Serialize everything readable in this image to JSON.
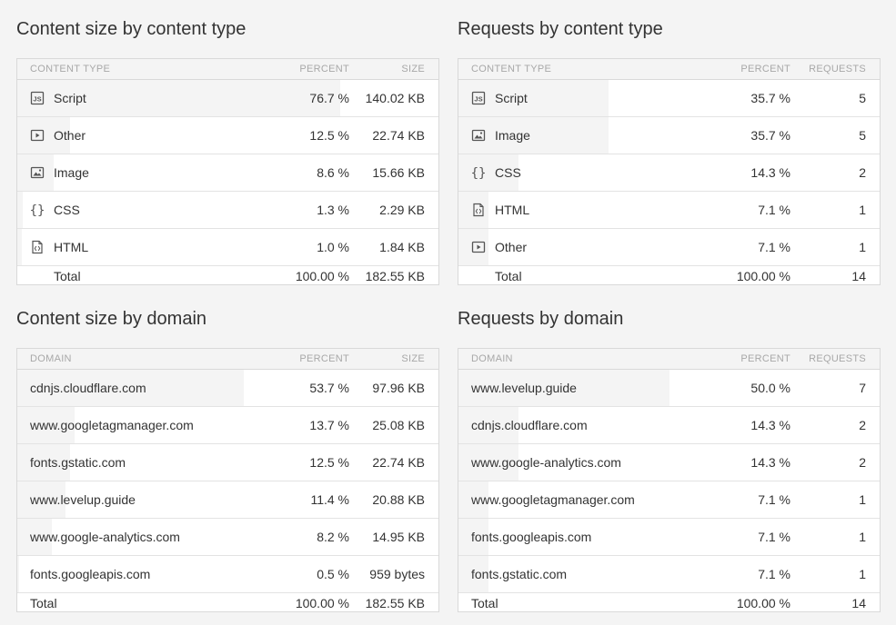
{
  "panels": {
    "size_type": {
      "title": "Content size by content type",
      "headers": {
        "name": "CONTENT TYPE",
        "pct": "PERCENT",
        "val": "SIZE"
      },
      "rows": [
        {
          "icon": "js-file-icon",
          "name": "Script",
          "pct": "76.7 %",
          "val": "140.02 KB",
          "fraction": 0.767
        },
        {
          "icon": "video-icon",
          "name": "Other",
          "pct": "12.5 %",
          "val": "22.74 KB",
          "fraction": 0.125
        },
        {
          "icon": "image-icon",
          "name": "Image",
          "pct": "8.6 %",
          "val": "15.66 KB",
          "fraction": 0.086
        },
        {
          "icon": "css-braces-icon",
          "name": "CSS",
          "pct": "1.3 %",
          "val": "2.29 KB",
          "fraction": 0.013
        },
        {
          "icon": "html-file-icon",
          "name": "HTML",
          "pct": "1.0 %",
          "val": "1.84 KB",
          "fraction": 0.01
        }
      ],
      "total": {
        "label": "Total",
        "pct": "100.00 %",
        "val": "182.55 KB"
      }
    },
    "req_type": {
      "title": "Requests by content type",
      "headers": {
        "name": "CONTENT TYPE",
        "pct": "PERCENT",
        "val": "REQUESTS"
      },
      "rows": [
        {
          "icon": "js-file-icon",
          "name": "Script",
          "pct": "35.7 %",
          "val": "5",
          "fraction": 0.357
        },
        {
          "icon": "image-icon",
          "name": "Image",
          "pct": "35.7 %",
          "val": "5",
          "fraction": 0.357
        },
        {
          "icon": "css-braces-icon",
          "name": "CSS",
          "pct": "14.3 %",
          "val": "2",
          "fraction": 0.143
        },
        {
          "icon": "html-file-icon",
          "name": "HTML",
          "pct": "7.1 %",
          "val": "1",
          "fraction": 0.071
        },
        {
          "icon": "video-icon",
          "name": "Other",
          "pct": "7.1 %",
          "val": "1",
          "fraction": 0.071
        }
      ],
      "total": {
        "label": "Total",
        "pct": "100.00 %",
        "val": "14"
      }
    },
    "size_domain": {
      "title": "Content size by domain",
      "headers": {
        "name": "DOMAIN",
        "pct": "PERCENT",
        "val": "SIZE"
      },
      "rows": [
        {
          "name": "cdnjs.cloudflare.com",
          "pct": "53.7 %",
          "val": "97.96 KB",
          "fraction": 0.537
        },
        {
          "name": "www.googletagmanager.com",
          "pct": "13.7 %",
          "val": "25.08 KB",
          "fraction": 0.137
        },
        {
          "name": "fonts.gstatic.com",
          "pct": "12.5 %",
          "val": "22.74 KB",
          "fraction": 0.125
        },
        {
          "name": "www.levelup.guide",
          "pct": "11.4 %",
          "val": "20.88 KB",
          "fraction": 0.114
        },
        {
          "name": "www.google-analytics.com",
          "pct": "8.2 %",
          "val": "14.95 KB",
          "fraction": 0.082
        },
        {
          "name": "fonts.googleapis.com",
          "pct": "0.5 %",
          "val": "959 bytes",
          "fraction": 0.005
        }
      ],
      "total": {
        "label": "Total",
        "pct": "100.00 %",
        "val": "182.55 KB"
      }
    },
    "req_domain": {
      "title": "Requests by domain",
      "headers": {
        "name": "DOMAIN",
        "pct": "PERCENT",
        "val": "REQUESTS"
      },
      "rows": [
        {
          "name": "www.levelup.guide",
          "pct": "50.0 %",
          "val": "7",
          "fraction": 0.5
        },
        {
          "name": "cdnjs.cloudflare.com",
          "pct": "14.3 %",
          "val": "2",
          "fraction": 0.143
        },
        {
          "name": "www.google-analytics.com",
          "pct": "14.3 %",
          "val": "2",
          "fraction": 0.143
        },
        {
          "name": "www.googletagmanager.com",
          "pct": "7.1 %",
          "val": "1",
          "fraction": 0.071
        },
        {
          "name": "fonts.googleapis.com",
          "pct": "7.1 %",
          "val": "1",
          "fraction": 0.071
        },
        {
          "name": "fonts.gstatic.com",
          "pct": "7.1 %",
          "val": "1",
          "fraction": 0.071
        }
      ],
      "total": {
        "label": "Total",
        "pct": "100.00 %",
        "val": "14"
      }
    }
  }
}
